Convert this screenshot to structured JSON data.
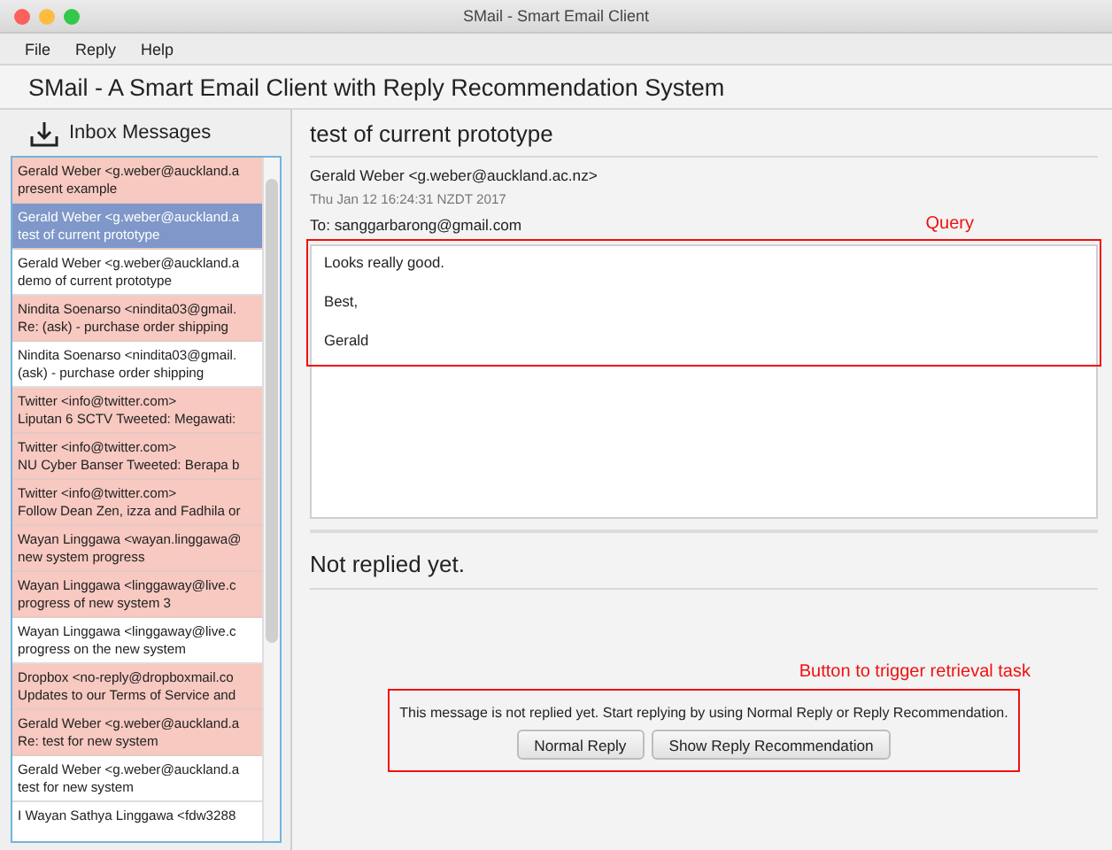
{
  "window": {
    "title": "SMail - Smart Email Client"
  },
  "menu": [
    "File",
    "Reply",
    "Help"
  ],
  "app_title": "SMail - A Smart Email Client with Reply Recommendation System",
  "inbox": {
    "title": "Inbox Messages",
    "messages": [
      {
        "sender": "Gerald Weber <g.weber@auckland.a",
        "subject": "present example",
        "replied": false,
        "selected": false
      },
      {
        "sender": "Gerald Weber <g.weber@auckland.a",
        "subject": "test of current prototype",
        "selected": true
      },
      {
        "sender": "Gerald Weber <g.weber@auckland.a",
        "subject": "demo of current prototype",
        "replied": true,
        "selected": false
      },
      {
        "sender": "Nindita Soenarso <nindita03@gmail.",
        "subject": "Re: (ask) - purchase order shipping",
        "replied": false,
        "selected": false
      },
      {
        "sender": "Nindita Soenarso <nindita03@gmail.",
        "subject": "(ask) - purchase order shipping",
        "replied": true,
        "selected": false
      },
      {
        "sender": "Twitter <info@twitter.com>",
        "subject": "Liputan 6 SCTV Tweeted: Megawati:",
        "replied": false,
        "selected": false
      },
      {
        "sender": "Twitter <info@twitter.com>",
        "subject": "NU Cyber Banser Tweeted: Berapa b",
        "replied": false,
        "selected": false
      },
      {
        "sender": "Twitter <info@twitter.com>",
        "subject": "Follow Dean Zen, izza and Fadhila or",
        "replied": false,
        "selected": false
      },
      {
        "sender": "Wayan Linggawa <wayan.linggawa@",
        "subject": "new system progress",
        "replied": false,
        "selected": false
      },
      {
        "sender": "Wayan Linggawa <linggaway@live.c",
        "subject": "progress of new system 3",
        "replied": false,
        "selected": false
      },
      {
        "sender": "Wayan Linggawa <linggaway@live.c",
        "subject": "progress on the new system",
        "replied": true,
        "selected": false
      },
      {
        "sender": "Dropbox <no-reply@dropboxmail.co",
        "subject": "Updates to our Terms of Service and",
        "replied": false,
        "selected": false
      },
      {
        "sender": "Gerald Weber <g.weber@auckland.a",
        "subject": "Re: test for new system",
        "replied": false,
        "selected": false
      },
      {
        "sender": "Gerald Weber <g.weber@auckland.a",
        "subject": "test for new system",
        "replied": true,
        "selected": false
      },
      {
        "sender": "I Wayan Sathya Linggawa <fdw3288",
        "replied": true,
        "selected": false
      }
    ]
  },
  "message": {
    "subject": "test of current prototype",
    "from": "Gerald Weber <g.weber@auckland.ac.nz>",
    "date": "Thu Jan 12 16:24:31 NZDT 2017",
    "to": "To: sanggarbarong@gmail.com",
    "body": [
      "Looks really good.",
      "Best,",
      "Gerald"
    ]
  },
  "reply": {
    "heading": "Not replied yet.",
    "notice": "This message is not replied yet. Start replying by using Normal Reply or Reply Recommendation.",
    "buttons": [
      "Normal Reply",
      "Show Reply Recommendation"
    ]
  },
  "annotations": {
    "query": "Query",
    "buttons": "Button to trigger retrieval task"
  }
}
